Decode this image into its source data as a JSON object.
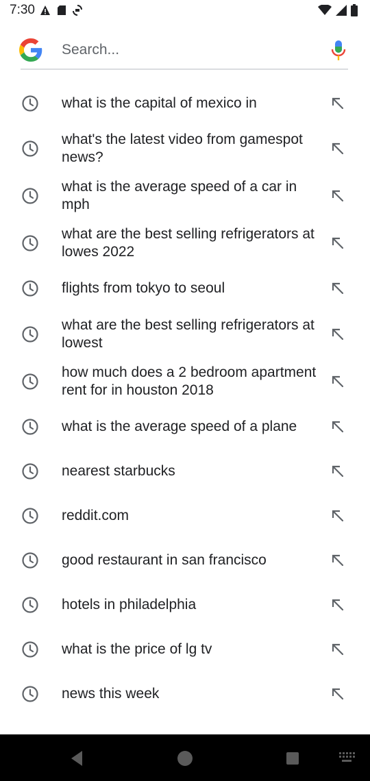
{
  "status_bar": {
    "time": "7:30",
    "left_icons": [
      "warning-icon",
      "sd-card-icon",
      "sync-icon"
    ],
    "right_icons": [
      "wifi-icon",
      "signal-icon",
      "battery-icon"
    ]
  },
  "search": {
    "placeholder": "Search...",
    "value": ""
  },
  "suggestions": [
    {
      "text": "what is the capital of mexico in"
    },
    {
      "text": "what's the latest video from gamespot news?"
    },
    {
      "text": "what is the average speed of a car in mph"
    },
    {
      "text": "what are the best selling refrigerators at lowes 2022"
    },
    {
      "text": "flights from tokyo to seoul"
    },
    {
      "text": "what are the best selling refrigerators at lowest"
    },
    {
      "text": "how much does a 2 bedroom apartment rent for in houston 2018"
    },
    {
      "text": "what is the average speed of a plane"
    },
    {
      "text": "nearest starbucks"
    },
    {
      "text": "reddit.com"
    },
    {
      "text": "good restaurant in san francisco"
    },
    {
      "text": "hotels in philadelphia"
    },
    {
      "text": "what is the price of lg tv"
    },
    {
      "text": "news this week"
    }
  ],
  "colors": {
    "google_blue": "#4285F4",
    "google_red": "#EA4335",
    "google_yellow": "#FBBC05",
    "google_green": "#34A853",
    "icon_gray": "#5f6368",
    "nav_bg": "#000000"
  },
  "nav": {
    "buttons": [
      "back-icon",
      "home-icon",
      "recents-icon",
      "keyboard-icon"
    ]
  }
}
